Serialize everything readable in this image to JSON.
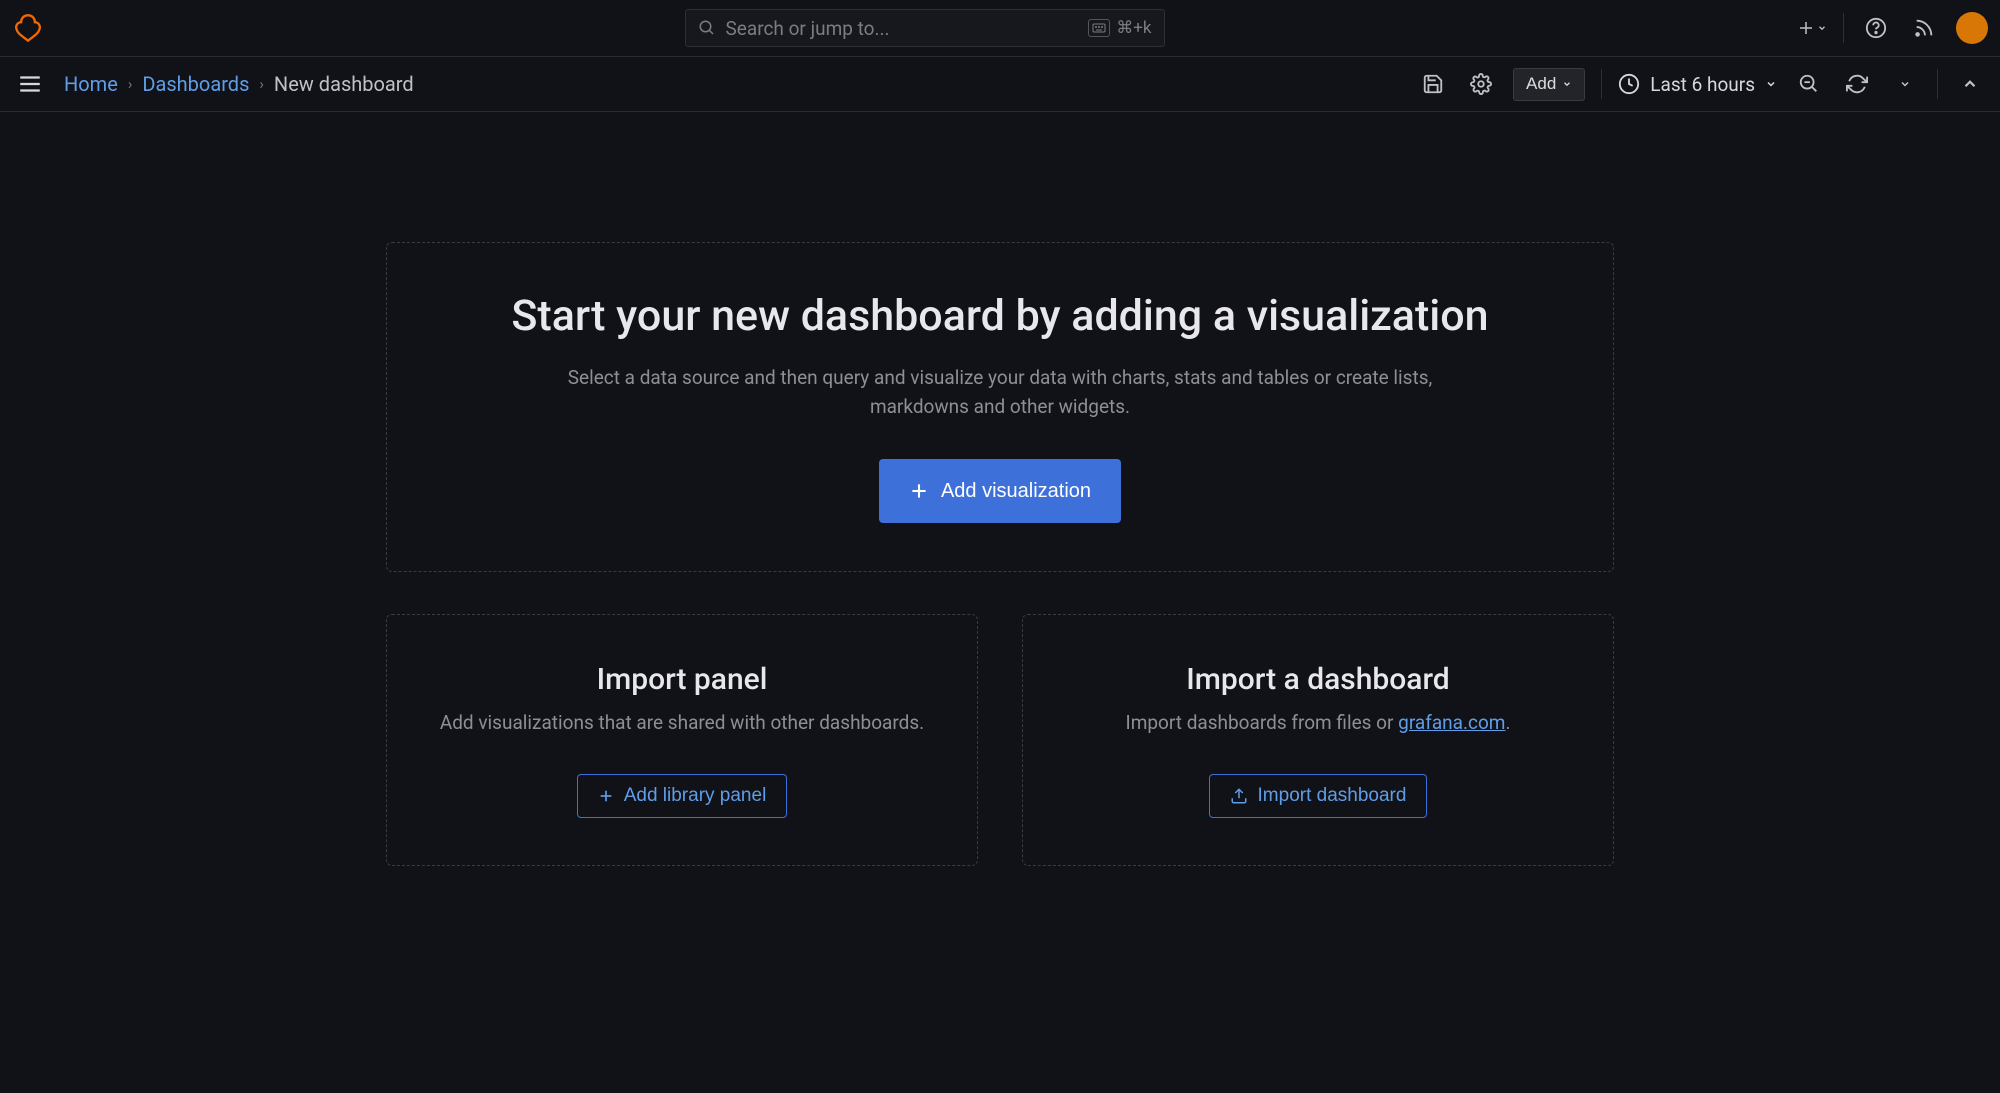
{
  "search": {
    "placeholder": "Search or jump to...",
    "shortcut": "⌘+k"
  },
  "breadcrumb": {
    "home": "Home",
    "dashboards": "Dashboards",
    "current": "New dashboard"
  },
  "toolbar": {
    "add_label": "Add",
    "time_label": "Last 6 hours"
  },
  "hero": {
    "title": "Start your new dashboard by adding a visualization",
    "description": "Select a data source and then query and visualize your data with charts, stats and tables or create lists, markdowns and other widgets.",
    "cta": "Add visualization"
  },
  "import_panel": {
    "title": "Import panel",
    "description": "Add visualizations that are shared with other dashboards.",
    "cta": "Add library panel"
  },
  "import_dashboard": {
    "title": "Import a dashboard",
    "description_prefix": "Import dashboards from files or ",
    "description_link": "grafana.com",
    "description_suffix": ".",
    "cta": "Import dashboard"
  }
}
